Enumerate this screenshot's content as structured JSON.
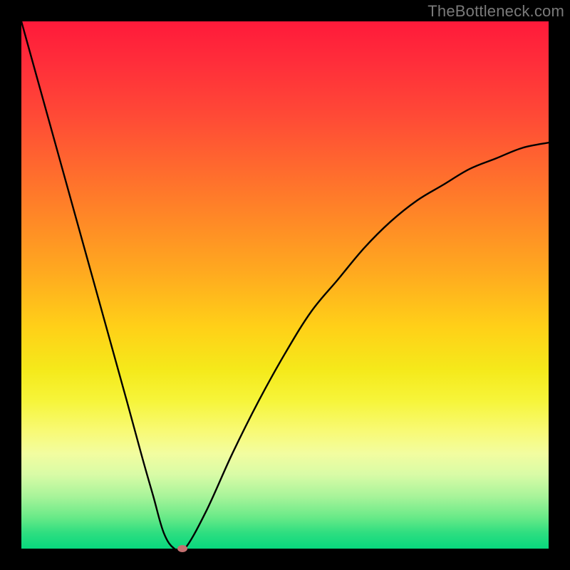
{
  "attribution": "TheBottleneck.com",
  "chart_data": {
    "type": "line",
    "title": "",
    "xlabel": "",
    "ylabel": "",
    "xlim": [
      0,
      100
    ],
    "ylim": [
      0,
      100
    ],
    "grid": false,
    "legend": false,
    "x": [
      0,
      5,
      10,
      15,
      20,
      23,
      25,
      27,
      29,
      31,
      35,
      40,
      45,
      50,
      55,
      60,
      65,
      70,
      75,
      80,
      85,
      90,
      95,
      100
    ],
    "values": [
      100,
      82,
      64,
      46,
      28,
      17,
      10,
      3,
      0,
      0,
      7,
      18,
      28,
      37,
      45,
      51,
      57,
      62,
      66,
      69,
      72,
      74,
      76,
      77
    ],
    "marker": {
      "x": 30.5,
      "y": 0
    },
    "background_gradient": {
      "direction": "vertical",
      "stops": [
        {
          "pos": 0.0,
          "color": "#ff1a3a"
        },
        {
          "pos": 0.5,
          "color": "#ffab1f"
        },
        {
          "pos": 0.72,
          "color": "#f6f53a"
        },
        {
          "pos": 1.0,
          "color": "#08d77e"
        }
      ]
    },
    "frame_color": "#000000",
    "line_color": "#000000",
    "marker_color": "#c47070"
  }
}
